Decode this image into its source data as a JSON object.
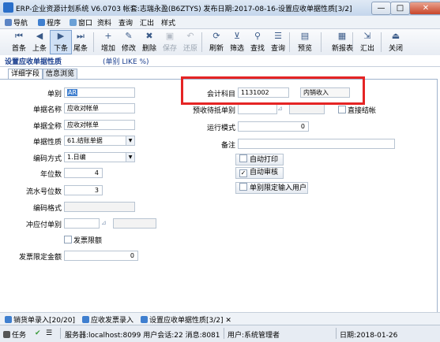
{
  "window": {
    "title": "ERP-企业资源计划系统 V6.0703 帐套:志瑞永盈(B6ZTYS) 发布日期:2017-08-16-设置应收单据性质[3/2]",
    "minimize": "—",
    "maximize": "□",
    "close": "✕"
  },
  "menu": [
    "导航",
    "程序",
    "窗口",
    "资料",
    "查询",
    "汇出",
    "样式"
  ],
  "toolbar": {
    "buttons": [
      {
        "label": "首条",
        "icon": "first-record-icon",
        "glyph": "⏮",
        "enabled": true
      },
      {
        "label": "上条",
        "icon": "prev-record-icon",
        "glyph": "◀",
        "enabled": true
      },
      {
        "label": "下条",
        "icon": "next-record-icon",
        "glyph": "▶",
        "enabled": true
      },
      {
        "label": "尾条",
        "icon": "last-record-icon",
        "glyph": "⏭",
        "enabled": true
      },
      {
        "label": "增加",
        "icon": "add-icon",
        "glyph": "+",
        "enabled": true
      },
      {
        "label": "修改",
        "icon": "edit-icon",
        "glyph": "✎",
        "enabled": true
      },
      {
        "label": "删除",
        "icon": "delete-icon",
        "glyph": "✖",
        "enabled": true
      },
      {
        "label": "保存",
        "icon": "save-icon",
        "glyph": "▣",
        "enabled": false
      },
      {
        "label": "还原",
        "icon": "undo-icon",
        "glyph": "↶",
        "enabled": false
      },
      {
        "label": "刷新",
        "icon": "refresh-icon",
        "glyph": "⟳",
        "enabled": true
      },
      {
        "label": "筛选",
        "icon": "filter-icon",
        "glyph": "⊻",
        "enabled": true
      },
      {
        "label": "查找",
        "icon": "find-icon",
        "glyph": "⚲",
        "enabled": true
      },
      {
        "label": "查询",
        "icon": "query-icon",
        "glyph": "☰",
        "enabled": true
      },
      {
        "label": "预览",
        "icon": "preview-icon",
        "glyph": "▤",
        "enabled": true
      },
      {
        "label": "新报表",
        "icon": "new-report-icon",
        "glyph": "▦",
        "enabled": true
      },
      {
        "label": "汇出",
        "icon": "export-icon",
        "glyph": "⇲",
        "enabled": true
      },
      {
        "label": "关闭",
        "icon": "exit-icon",
        "glyph": "⏏",
        "enabled": true
      }
    ]
  },
  "header": {
    "title": "设置应收单据性质",
    "filter": "(单别 LIKE %)"
  },
  "tabs": [
    "详细字段",
    "信息浏览"
  ],
  "form": {
    "labels": {
      "code": "单别",
      "name": "单据名称",
      "fullname": "单据全称",
      "nature": "单据性质",
      "encoding": "编码方式",
      "year_digits": "年位数",
      "serial_digits": "流水号位数",
      "format": "编码格式",
      "offset": "冲应付单别",
      "invoice_limit_chk": "发票限额",
      "invoice_limit_amount": "发票限定金额",
      "account": "会计科目",
      "pre_receive": "预收待抵单别",
      "direct_close": "直接结帐",
      "run_mode": "运行模式",
      "remark": "备注",
      "auto_print": "自动打印",
      "auto_audit": "自动审核",
      "code_user_limit": "单别限定输入用户"
    },
    "values": {
      "code": "AR",
      "name": "应收对帐单",
      "fullname": "应收对帐单",
      "nature": "61.结账单据",
      "encoding": "1.日编",
      "year_digits": "4",
      "serial_digits": "3",
      "format": "",
      "offset": "",
      "invoice_limit_amount": "0",
      "account": "1131002",
      "account_name": "内销收入",
      "pre_receive": "",
      "run_mode": "0",
      "remark": ""
    },
    "checks": {
      "invoice_limit": false,
      "direct_close": false,
      "auto_print": false,
      "auto_audit": true,
      "code_user_limit": false
    }
  },
  "bottom_tabs": [
    {
      "label": "销货单录入[20/20]"
    },
    {
      "label": "应收发票录入"
    },
    {
      "label": "设置应收单据性质[3/2]"
    }
  ],
  "status": {
    "task": "任务",
    "server": "服务器:localhost:8099 用户会话:22 消息:8081",
    "user": "用户:系统管理者",
    "date": "日期:2018-01-26"
  },
  "colors": {
    "highlight_box": "#e52424",
    "header_text": "#1b3f8f"
  }
}
